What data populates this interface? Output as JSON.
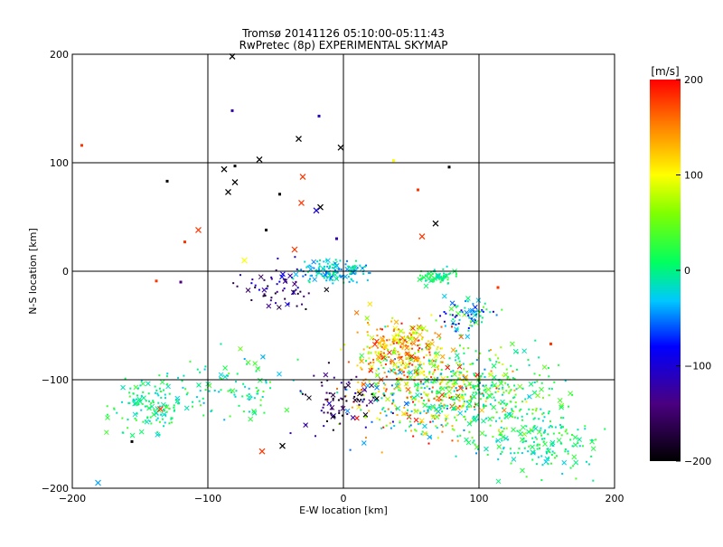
{
  "chart_data": [
    {
      "type": "scatter",
      "title": "Tromsø 20141126 05:10:00-05:11:43",
      "subtitle": "RwPretec (8p) EXPERIMENTAL SKYMAP",
      "xlabel": "E-W location [km]",
      "ylabel": "N-S location [km]",
      "xlim": [
        -200,
        200
      ],
      "ylim": [
        -200,
        200
      ],
      "x_ticks": [
        -200,
        -100,
        0,
        100,
        200
      ],
      "y_ticks": [
        -200,
        -100,
        0,
        100,
        200
      ],
      "x_tick_labels": [
        "−200",
        "−100",
        "0",
        "100",
        "200"
      ],
      "y_tick_labels": [
        "−200",
        "−100",
        "0",
        "100",
        "200"
      ],
      "grid": true,
      "color_value": "velocity [m/s]",
      "points": [
        {
          "x": -82,
          "y": 148,
          "v": -120
        },
        {
          "x": -18,
          "y": 143,
          "v": -110
        },
        {
          "x": -193,
          "y": 116,
          "v": 180
        },
        {
          "x": -117,
          "y": 27,
          "v": 180
        },
        {
          "x": -80,
          "y": 97,
          "v": -200
        },
        {
          "x": -130,
          "y": 83,
          "v": -200
        },
        {
          "x": 78,
          "y": 96,
          "v": -200
        },
        {
          "x": 55,
          "y": 75,
          "v": 180
        },
        {
          "x": -57,
          "y": 38,
          "v": -200
        },
        {
          "x": -47,
          "y": 71,
          "v": -200
        },
        {
          "x": 37,
          "y": 102,
          "v": 100
        },
        {
          "x": -5,
          "y": 30,
          "v": -120
        },
        {
          "x": -138,
          "y": -9,
          "v": 180
        },
        {
          "x": -120,
          "y": -10,
          "v": -140
        },
        {
          "x": 114,
          "y": -15,
          "v": 180
        },
        {
          "x": 153,
          "y": -67,
          "v": 180
        },
        {
          "x": -156,
          "y": -157,
          "v": -200
        }
      ],
      "crosses": [
        {
          "x": -33,
          "y": 122,
          "v": -200
        },
        {
          "x": -2,
          "y": 114,
          "v": -200
        },
        {
          "x": -88,
          "y": 94,
          "v": -200
        },
        {
          "x": -62,
          "y": 103,
          "v": -200
        },
        {
          "x": -30,
          "y": 87,
          "v": 180
        },
        {
          "x": -80,
          "y": 82,
          "v": -200
        },
        {
          "x": -85,
          "y": 73,
          "v": -200
        },
        {
          "x": -31,
          "y": 63,
          "v": 180
        },
        {
          "x": -17,
          "y": 59,
          "v": -200
        },
        {
          "x": -20,
          "y": 56,
          "v": -100
        },
        {
          "x": -107,
          "y": 38,
          "v": 180
        },
        {
          "x": 68,
          "y": 44,
          "v": -200
        },
        {
          "x": 58,
          "y": 32,
          "v": 180
        },
        {
          "x": -36,
          "y": 20,
          "v": 180
        },
        {
          "x": -73,
          "y": 10,
          "v": 100
        },
        {
          "x": -135,
          "y": -127,
          "v": 180
        },
        {
          "x": -60,
          "y": -166,
          "v": 180
        },
        {
          "x": -45,
          "y": -161,
          "v": -200
        },
        {
          "x": -181,
          "y": -195,
          "v": -40
        },
        {
          "x": -82,
          "y": 198,
          "v": -200
        }
      ]
    },
    {
      "type": "heatmap",
      "title": "[m/s]",
      "range": [
        -200,
        200
      ],
      "tick_values": [
        200,
        100,
        0,
        -100,
        -200
      ],
      "tick_labels": [
        "200",
        "100",
        "0",
        "−100",
        "−200"
      ]
    }
  ]
}
